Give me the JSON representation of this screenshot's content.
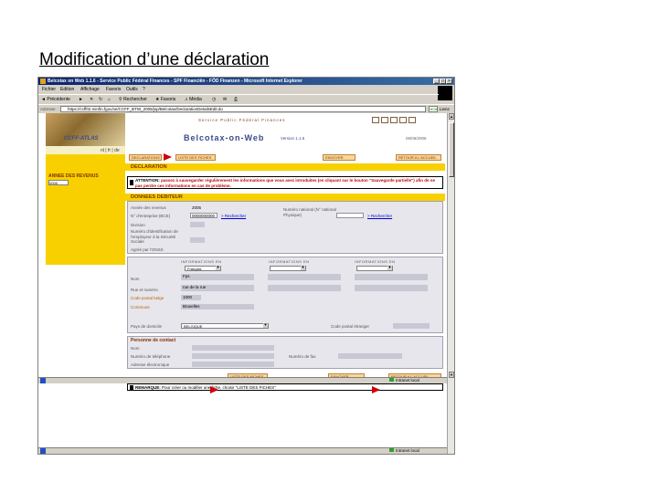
{
  "slide": {
    "title": "Modification d’une déclaration"
  },
  "window": {
    "title": "Belcotax on Web 1.1.6 - Service Public Fédéral Finances - SPF Financiën - FÖD Finanzen - Microsoft Internet Explorer",
    "menu": [
      "Fichier",
      "Edition",
      "Affichage",
      "Favoris",
      "Outils",
      "?"
    ],
    "toolbar": {
      "back": "Précédente",
      "search": "Rechercher",
      "favorites": "Favoris",
      "media": "Média"
    },
    "address_label": "Adresse",
    "address": "https://ccff02.minfin.fgov.be/CCFF_BTW_2005/jsp/Belcotax/DeclarationDetailsEdit.do",
    "go_label": "OK",
    "links_label": "Liens",
    "status_zone": "Intranet local"
  },
  "site": {
    "brand": "CCFF-ATLAS",
    "langs": "nl | fr | de",
    "header_links": "Service Public Fédéral Finances",
    "app_title": "Belcotax-on-Web",
    "version": "Version 1.1.6",
    "date": "06/06/2006",
    "sidebar_label": "ANNEE DES REVENUS",
    "sidebar_year": "2005"
  },
  "nav": {
    "declarations": "DECLARATIONS",
    "list_fiches": "LISTE DES FICHES",
    "send": "ENVOYER",
    "back_home": "RETOUR A L'ACCUEIL"
  },
  "declaration": {
    "section": "DECLARATION",
    "notice_label": "ATTENTION:",
    "notice_text": " passez à sauvegarder régulièrement les informations que vous avez introduites (en cliquant sur le bouton \"Sauvegarde partielle\") afin de ne pas perdre ces informations en cas de problème."
  },
  "debtor": {
    "section": "DONNEES DEBITEUR",
    "year_label": "Année des revenus",
    "year_value": "2005",
    "company_label": "N° d'entreprise (BCE)",
    "company_value": "0000000000",
    "company_link": "> Rechercher",
    "natnum_label": "Numéro national (N° national Physique)",
    "natnum_link": "> Rechercher",
    "division_label": "Division",
    "rsz_label": "Numéro d'identification de l'employeur à la Sécurité Sociale",
    "approved_label": "Agréé par l'ONSS",
    "col_info1": "INFORMATIONS EN",
    "col_info2": "INFORMATIONS EN",
    "col_info3": "INFORMATIONS EN",
    "lang1": "Français",
    "name_label": "Nom",
    "name_value": "Fps",
    "street_label": "Rue et numéro",
    "street_value": "rue de la rue",
    "postal_label": "Code postal belge",
    "postal_value": "1000",
    "city_label": "Commune",
    "city_value": "Bruxelles",
    "country_label": "Pays de domicile",
    "country_value": "BELGIQUE",
    "foreign_postal_label": "Code postal étranger"
  },
  "contact": {
    "section": "Personne de contact",
    "name_label": "Nom",
    "phone_label": "Numéro de téléphone",
    "fax_label": "Numéro de fax",
    "email_label": "Adresse électronique"
  },
  "bottom_nav": {
    "list_fiches": "LISTE DES FICHES",
    "send": "ENVOYER",
    "back_home": "RETOUR A L'ACCUEIL"
  },
  "remark": {
    "label": "REMARQUE:",
    "text": " Pour créer ou modifier une fiche, choisir \"LISTE DES FICHES\""
  }
}
